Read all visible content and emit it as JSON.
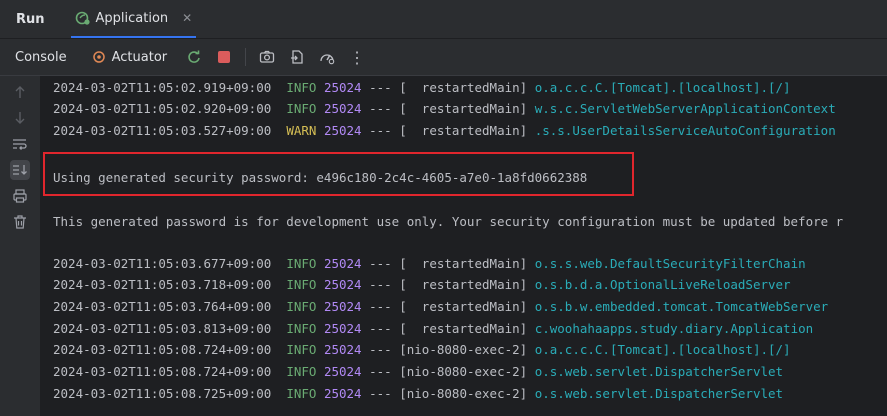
{
  "header": {
    "run_label": "Run",
    "tab_label": "Application",
    "close_glyph": "✕"
  },
  "toolbar": {
    "console_label": "Console",
    "actuator_label": "Actuator",
    "more_glyph": "⋮"
  },
  "log": {
    "lines": [
      {
        "ts": "2024-03-02T11:05:02.919+09:00",
        "level": "INFO",
        "pid": "25024",
        "sep": "---",
        "thread": "[  restartedMain]",
        "logger": "o.a.c.c.C.[Tomcat].[localhost].[/]"
      },
      {
        "ts": "2024-03-02T11:05:02.920+09:00",
        "level": "INFO",
        "pid": "25024",
        "sep": "---",
        "thread": "[  restartedMain]",
        "logger": "w.s.c.ServletWebServerApplicationContext"
      },
      {
        "ts": "2024-03-02T11:05:03.527+09:00",
        "level": "WARN",
        "pid": "25024",
        "sep": "---",
        "thread": "[  restartedMain]",
        "logger": ".s.s.UserDetailsServiceAutoConfiguration"
      },
      {
        "ts": "2024-03-02T11:05:03.677+09:00",
        "level": "INFO",
        "pid": "25024",
        "sep": "---",
        "thread": "[  restartedMain]",
        "logger": "o.s.s.web.DefaultSecurityFilterChain"
      },
      {
        "ts": "2024-03-02T11:05:03.718+09:00",
        "level": "INFO",
        "pid": "25024",
        "sep": "---",
        "thread": "[  restartedMain]",
        "logger": "o.s.b.d.a.OptionalLiveReloadServer"
      },
      {
        "ts": "2024-03-02T11:05:03.764+09:00",
        "level": "INFO",
        "pid": "25024",
        "sep": "---",
        "thread": "[  restartedMain]",
        "logger": "o.s.b.w.embedded.tomcat.TomcatWebServer"
      },
      {
        "ts": "2024-03-02T11:05:03.813+09:00",
        "level": "INFO",
        "pid": "25024",
        "sep": "---",
        "thread": "[  restartedMain]",
        "logger": "c.woohahaapps.study.diary.Application"
      },
      {
        "ts": "2024-03-02T11:05:08.724+09:00",
        "level": "INFO",
        "pid": "25024",
        "sep": "---",
        "thread": "[nio-8080-exec-2]",
        "logger": "o.a.c.c.C.[Tomcat].[localhost].[/]"
      },
      {
        "ts": "2024-03-02T11:05:08.724+09:00",
        "level": "INFO",
        "pid": "25024",
        "sep": "---",
        "thread": "[nio-8080-exec-2]",
        "logger": "o.s.web.servlet.DispatcherServlet"
      },
      {
        "ts": "2024-03-02T11:05:08.725+09:00",
        "level": "INFO",
        "pid": "25024",
        "sep": "---",
        "thread": "[nio-8080-exec-2]",
        "logger": "o.s.web.servlet.DispatcherServlet"
      }
    ],
    "password_message": "Using generated security password: e496c180-2c4c-4605-a7e0-1a8fd0662388",
    "dev_message": "This generated password is for development use only. Your security configuration must be updated before r"
  },
  "colors": {
    "info": "#6aab73",
    "warn": "#d6bf55",
    "pid": "#b189f5",
    "logger": "#2aacb8",
    "highlight": "#e0262d"
  }
}
